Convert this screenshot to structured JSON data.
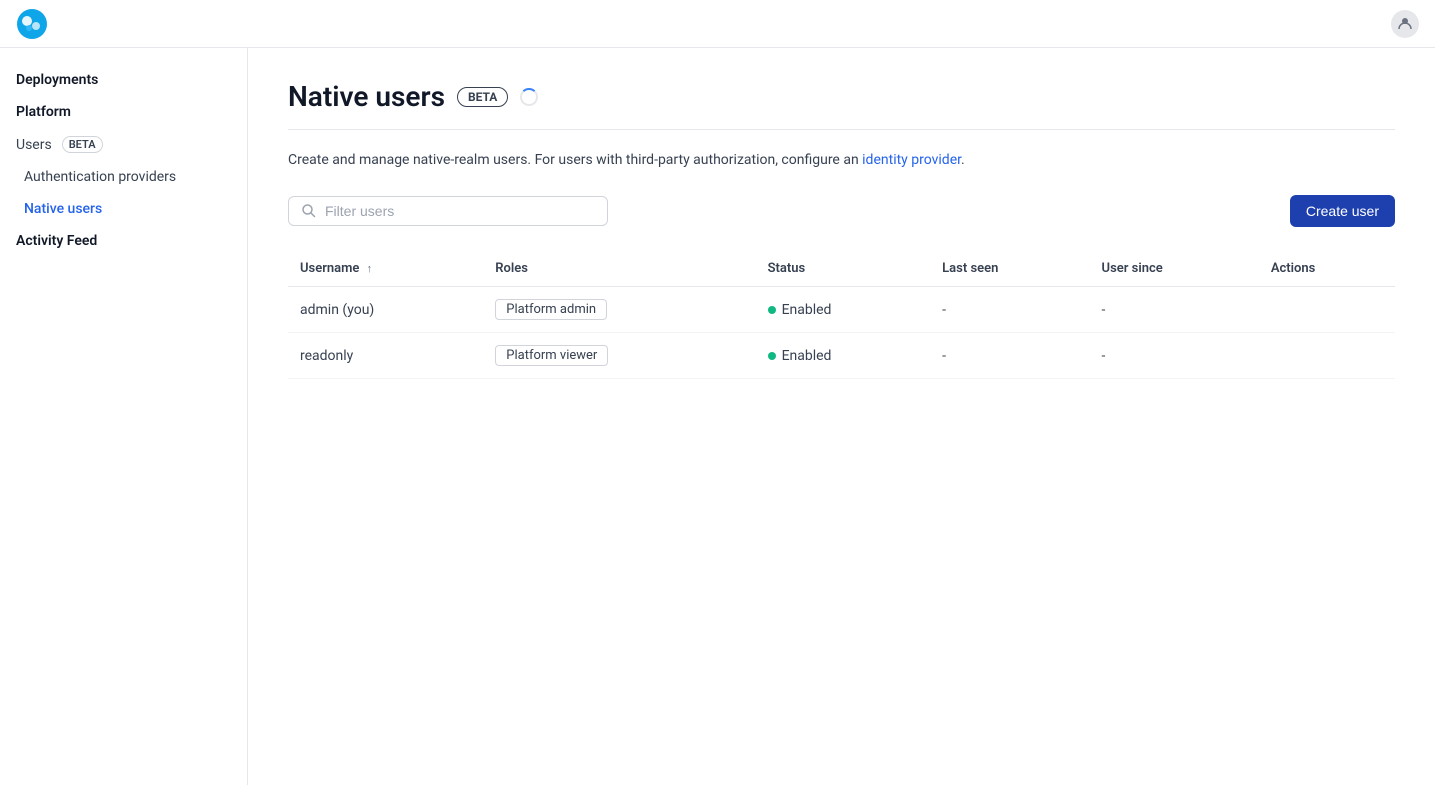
{
  "topbar": {
    "logo_alt": "App logo"
  },
  "sidebar": {
    "items": [
      {
        "id": "deployments",
        "label": "Deployments",
        "indent": false,
        "active": false,
        "badge": null
      },
      {
        "id": "platform",
        "label": "Platform",
        "indent": false,
        "active": false,
        "badge": null,
        "section": true
      },
      {
        "id": "users",
        "label": "Users",
        "indent": false,
        "active": false,
        "badge": "BETA"
      },
      {
        "id": "auth-providers",
        "label": "Authentication providers",
        "indent": true,
        "active": false,
        "badge": null
      },
      {
        "id": "native-users",
        "label": "Native users",
        "indent": true,
        "active": true,
        "badge": null
      },
      {
        "id": "activity-feed",
        "label": "Activity Feed",
        "indent": false,
        "active": false,
        "badge": null
      }
    ]
  },
  "page": {
    "title": "Native users",
    "beta_label": "BETA",
    "description_prefix": "Create and manage native-realm users. For users with third-party authorization, configure an ",
    "identity_provider_link": "identity provider",
    "description_suffix": "."
  },
  "toolbar": {
    "filter_placeholder": "Filter users",
    "create_button_label": "Create user"
  },
  "table": {
    "columns": [
      {
        "id": "username",
        "label": "Username",
        "sortable": true,
        "sort_dir": "asc"
      },
      {
        "id": "roles",
        "label": "Roles",
        "sortable": false
      },
      {
        "id": "status",
        "label": "Status",
        "sortable": false
      },
      {
        "id": "last_seen",
        "label": "Last seen",
        "sortable": false
      },
      {
        "id": "user_since",
        "label": "User since",
        "sortable": false
      },
      {
        "id": "actions",
        "label": "Actions",
        "sortable": false
      }
    ],
    "rows": [
      {
        "username": "admin (you)",
        "role": "Platform admin",
        "status": "Enabled",
        "last_seen": "-",
        "user_since": "-"
      },
      {
        "username": "readonly",
        "role": "Platform viewer",
        "status": "Enabled",
        "last_seen": "-",
        "user_since": "-"
      }
    ]
  }
}
